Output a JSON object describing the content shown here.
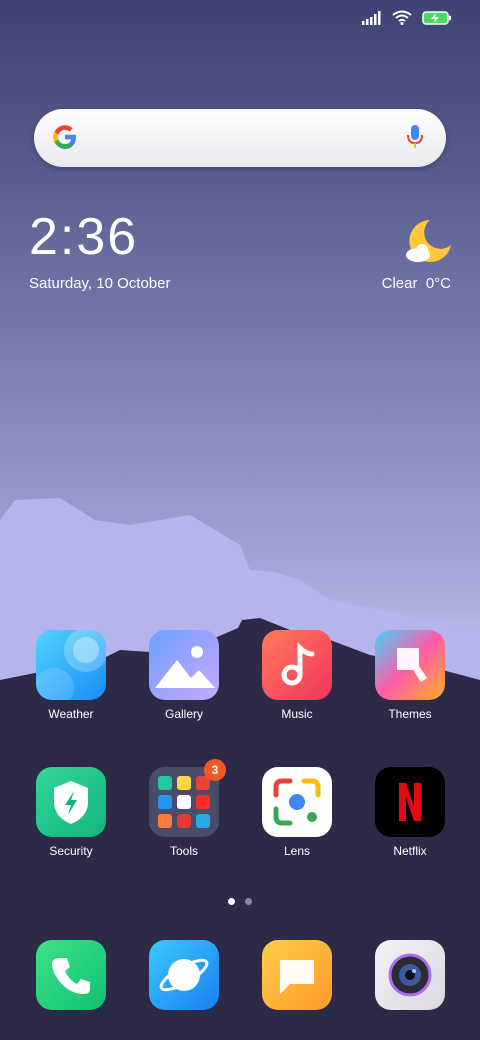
{
  "status_bar": {
    "signal": "signal-icon",
    "wifi": "wifi-icon",
    "battery": "battery-charging-icon"
  },
  "search": {
    "logo": "google-logo",
    "mic": "mic-icon"
  },
  "clock": {
    "time": "2:36",
    "date": "Saturday, 10 October"
  },
  "weather": {
    "icon": "moon-cloud-icon",
    "text": "Clear  0°C"
  },
  "apps": [
    {
      "label": "Weather"
    },
    {
      "label": "Gallery"
    },
    {
      "label": "Music"
    },
    {
      "label": "Themes"
    },
    {
      "label": "Security"
    },
    {
      "label": "Tools",
      "badge": "3"
    },
    {
      "label": "Lens"
    },
    {
      "label": "Netflix"
    }
  ],
  "dock": [
    {
      "icon": "phone-icon"
    },
    {
      "icon": "browser-icon"
    },
    {
      "icon": "messages-icon"
    },
    {
      "icon": "camera-icon"
    }
  ],
  "page_indicator": {
    "pages": 2,
    "current": 1
  },
  "colors": {
    "accent_badge": "#f25a23",
    "netflix_red": "#e50914"
  }
}
